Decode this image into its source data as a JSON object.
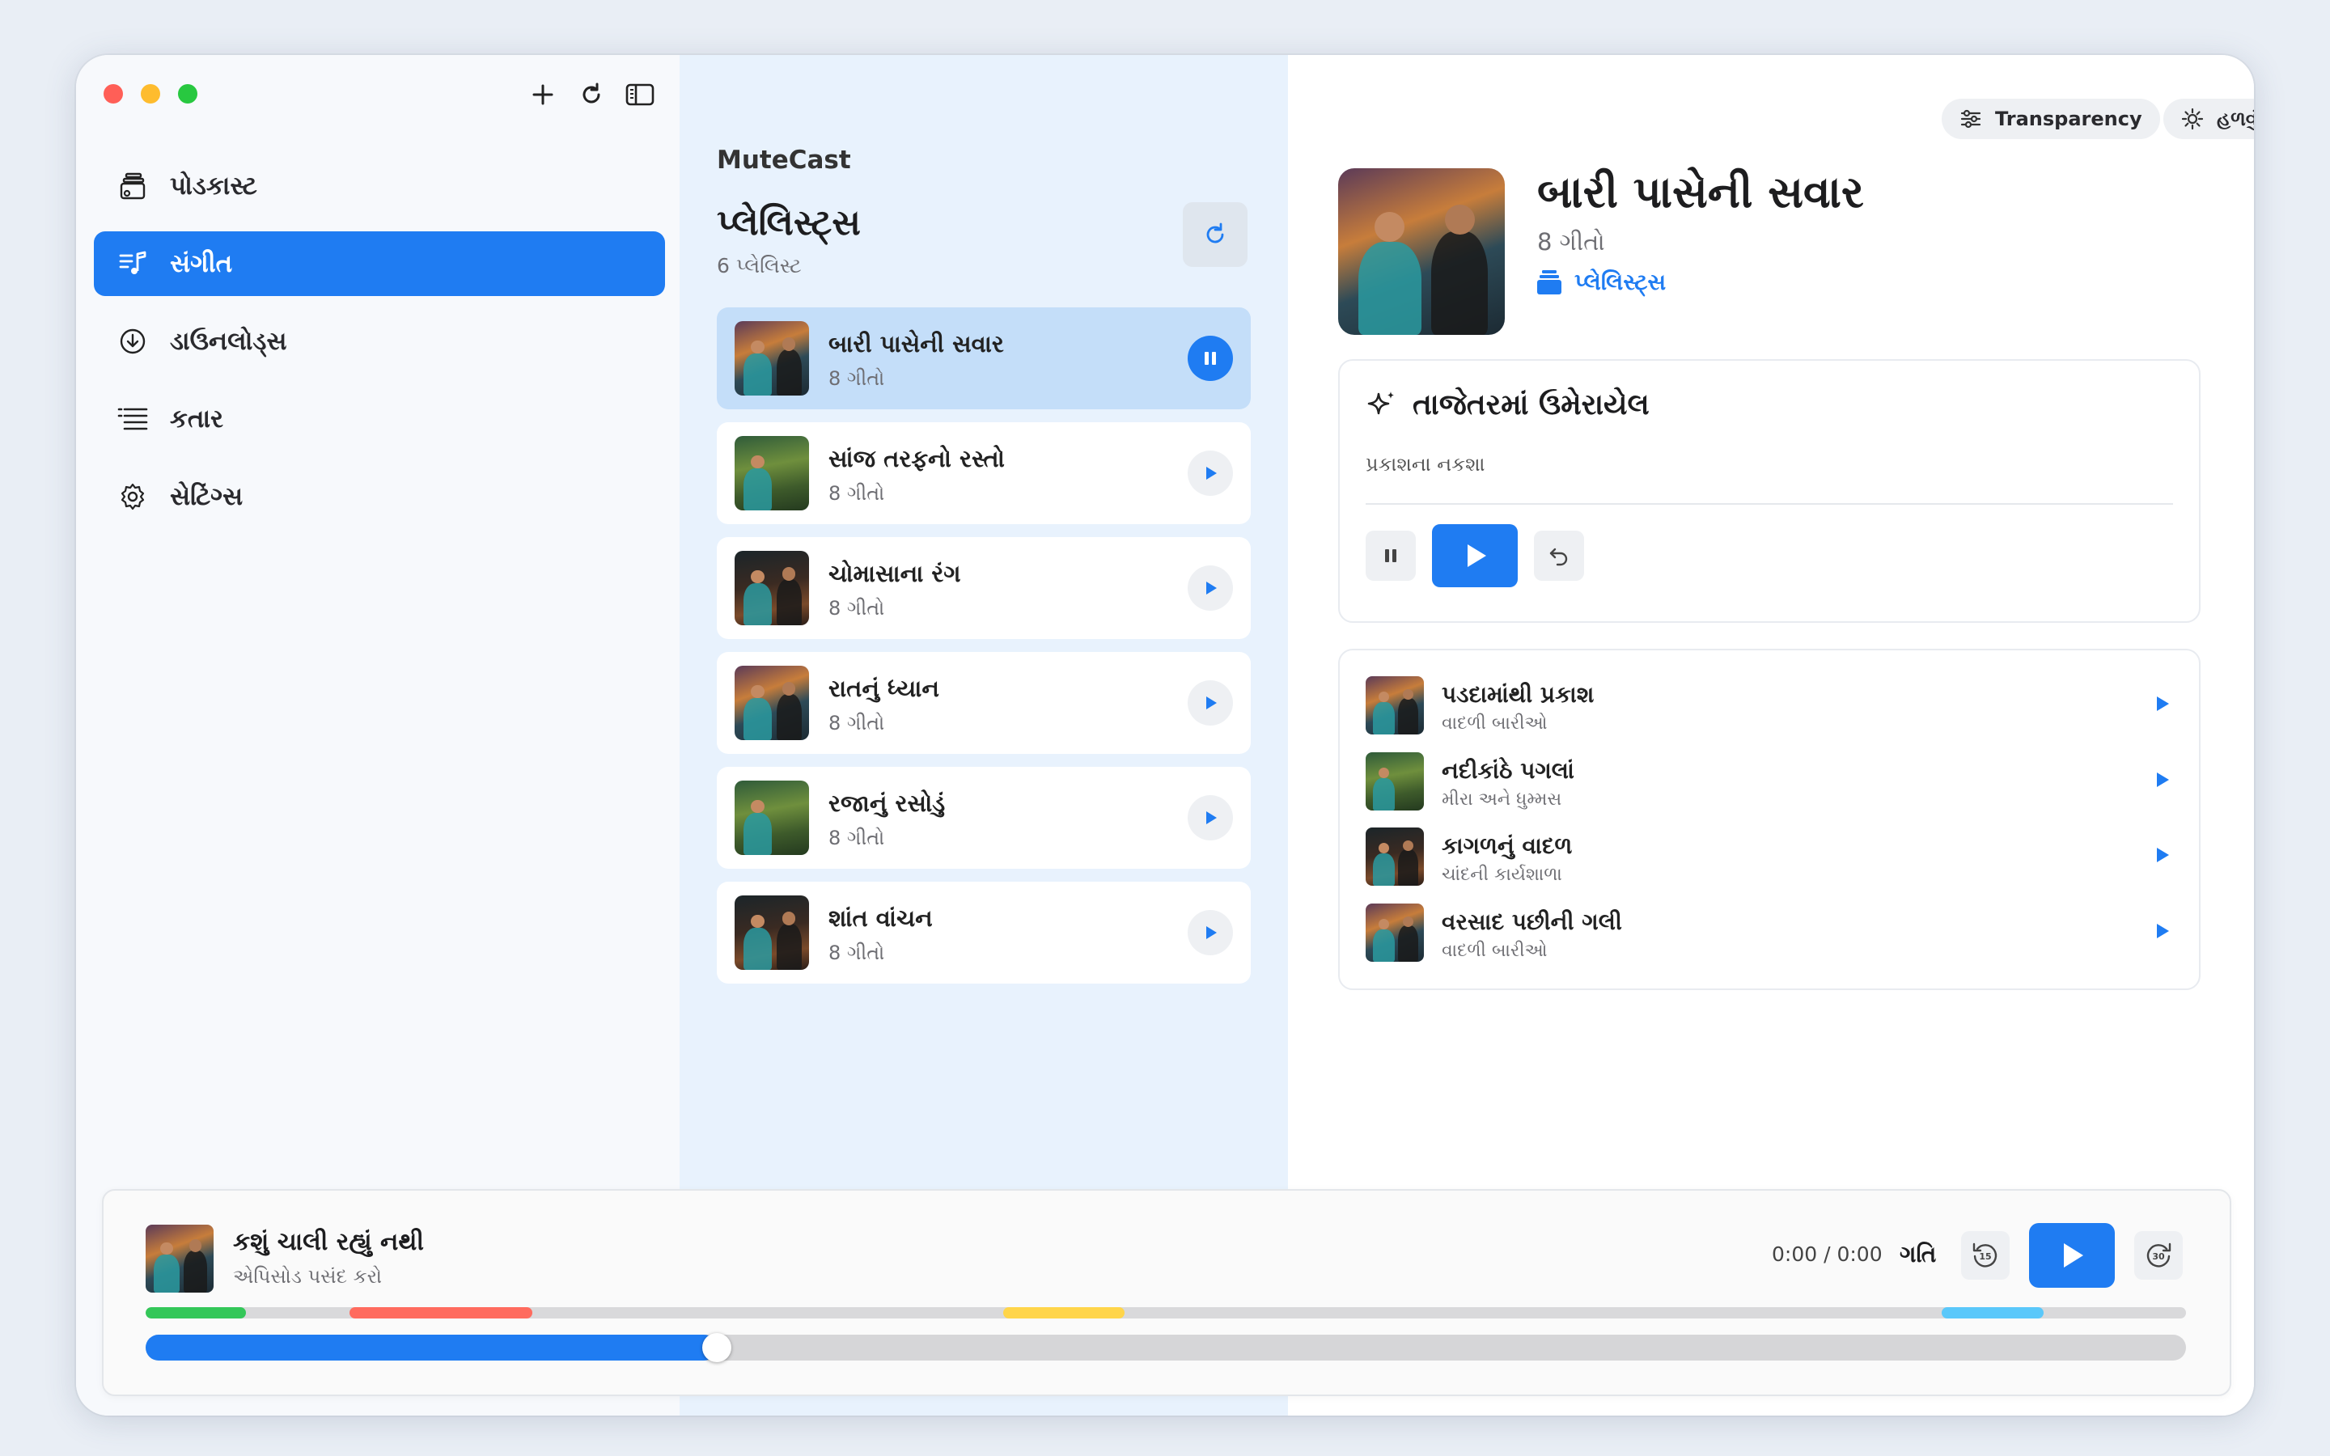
{
  "sidebar": {
    "items": [
      {
        "label": "પોડકાસ્ટ",
        "icon": "podcast-icon"
      },
      {
        "label": "સંગીત",
        "icon": "music-icon",
        "active": true
      },
      {
        "label": "ડાઉનલોડ્સ",
        "icon": "download-icon"
      },
      {
        "label": "કતાર",
        "icon": "queue-icon"
      },
      {
        "label": "સેટિંગ્સ",
        "icon": "gear-icon"
      }
    ]
  },
  "middle": {
    "app_name": "MuteCast",
    "title": "પ્લેલિસ્ટ્સ",
    "count": "6 પ્લેલિસ્ટ",
    "playlists": [
      {
        "name": "બારી પાસેની સવાર",
        "sub": "8 ગીતો",
        "playing": true
      },
      {
        "name": "સાંજ તરફનો રસ્તો",
        "sub": "8 ગીતો"
      },
      {
        "name": "ચોમાસાના રંગ",
        "sub": "8 ગીતો"
      },
      {
        "name": "રાતનું ધ્યાન",
        "sub": "8 ગીતો"
      },
      {
        "name": "રજાનું રસોડું",
        "sub": "8 ગીતો"
      },
      {
        "name": "શાંત વાંચન",
        "sub": "8 ગીતો"
      }
    ]
  },
  "right": {
    "transparency_label": "Transparency",
    "theme_label": "હળવું",
    "hero": {
      "title": "બારી પાસેની સવાર",
      "sub": "8 ગીતો",
      "link": "પ્લેલિસ્ટ્સ"
    },
    "recent": {
      "title": "તાજેતરમાં ઉમેરાયેલ",
      "track": "પ્રકાશના નકશા"
    },
    "tracks": [
      {
        "title": "પડદામાંથી પ્રકાશ",
        "sub": "વાદળી બારીઓ"
      },
      {
        "title": "નદીકાંઠે પગલાં",
        "sub": "મીરા અને ધુમ્મસ"
      },
      {
        "title": "કાગળનું વાદળ",
        "sub": "ચાંદની કાર્યશાળા"
      },
      {
        "title": "વરસાદ પછીની ગલી",
        "sub": "વાદળી બારીઓ"
      }
    ]
  },
  "player": {
    "title": "કશું ચાલી રહ્યું નથી",
    "sub": "એપિસોડ પસંદ કરો",
    "time": "0:00 / 0:00",
    "speed_label": "ગતિ",
    "skip_back": "15",
    "skip_forward": "30",
    "progress_fraction": 0.28,
    "chapter_colors": [
      "#34c759",
      "#ff6b5e",
      "#ffd54a",
      "#5ac8fa"
    ]
  },
  "colors": {
    "accent": "#1f7cf2"
  }
}
